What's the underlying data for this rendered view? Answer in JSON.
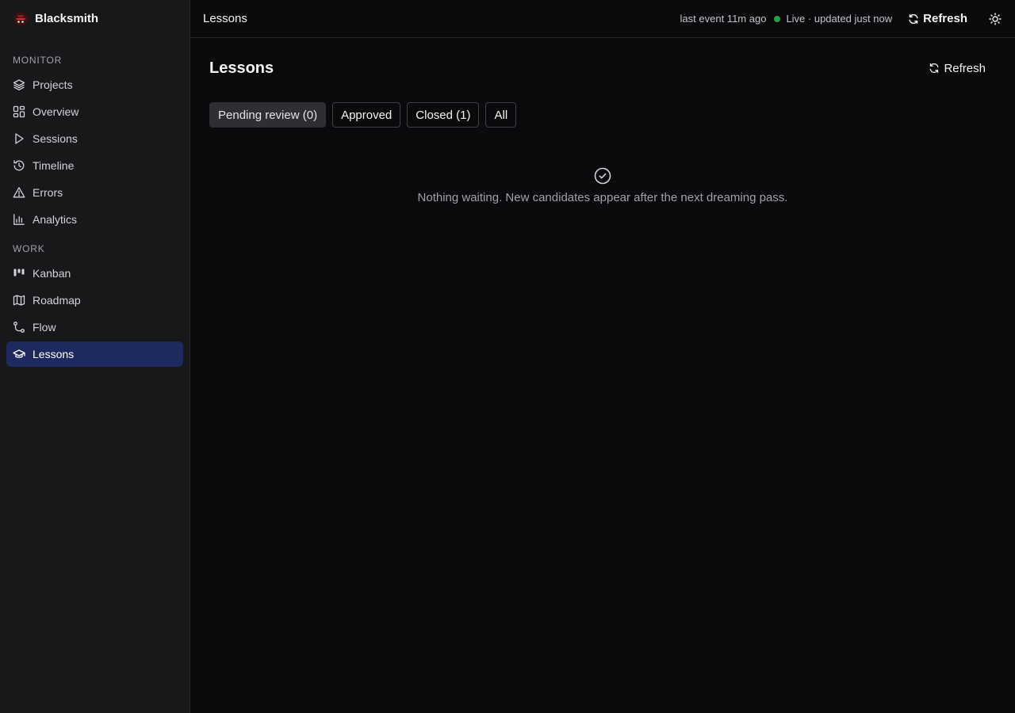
{
  "app": {
    "name": "Blacksmith"
  },
  "sidebar": {
    "sections": [
      {
        "label": "MONITOR",
        "items": [
          {
            "label": "Projects",
            "icon": "layers-icon"
          },
          {
            "label": "Overview",
            "icon": "dashboard-icon"
          },
          {
            "label": "Sessions",
            "icon": "play-icon"
          },
          {
            "label": "Timeline",
            "icon": "history-icon"
          },
          {
            "label": "Errors",
            "icon": "warning-icon"
          },
          {
            "label": "Analytics",
            "icon": "bar-chart-icon"
          }
        ]
      },
      {
        "label": "WORK",
        "items": [
          {
            "label": "Kanban",
            "icon": "kanban-icon"
          },
          {
            "label": "Roadmap",
            "icon": "map-icon"
          },
          {
            "label": "Flow",
            "icon": "git-flow-icon"
          },
          {
            "label": "Lessons",
            "icon": "graduation-cap-icon",
            "active": true
          }
        ]
      }
    ]
  },
  "topbar": {
    "title": "Lessons",
    "last_event": "last event 11m ago",
    "live_status": "Live · updated just now",
    "refresh_label": "Refresh"
  },
  "page": {
    "title": "Lessons",
    "refresh_label": "Refresh",
    "tabs": [
      {
        "label": "Pending review (0)",
        "active": true
      },
      {
        "label": "Approved"
      },
      {
        "label": "Closed (1)"
      },
      {
        "label": "All"
      }
    ],
    "empty_message": "Nothing waiting. New candidates appear after the next dreaming pass."
  },
  "colors": {
    "background": "#0a0a0c",
    "sidebar": "#18181b",
    "active_nav": "#1e2a5e",
    "live": "#22a34a"
  }
}
